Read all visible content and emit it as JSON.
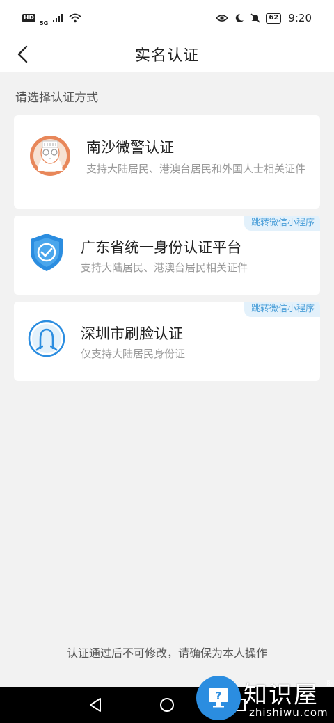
{
  "status_bar": {
    "left_badge": "HD",
    "network": "5G",
    "battery": "62",
    "time": "9:20"
  },
  "nav": {
    "title": "实名认证"
  },
  "section_label": "请选择认证方式",
  "cards": [
    {
      "title": "南沙微警认证",
      "desc": "支持大陆居民、港澳台居民和外国人士相关证件",
      "tag": "",
      "icon": "police-avatar-icon"
    },
    {
      "title": "广东省统一身份认证平台",
      "desc": "支持大陆居民、港澳台居民相关证件",
      "tag": "跳转微信小程序",
      "icon": "shield-check-icon"
    },
    {
      "title": "深圳市刷脸认证",
      "desc": "仅支持大陆居民身份证",
      "tag": "跳转微信小程序",
      "icon": "face-scan-icon"
    }
  ],
  "footer_note": "认证通过后不可修改，请确保为本人操作",
  "watermark": {
    "text": "知识屋",
    "reg": "®",
    "sub": "zhishiwu.com"
  },
  "colors": {
    "accent_blue": "#2b8de0",
    "tag_bg": "#e3f1fb",
    "tag_text": "#4a9ed8",
    "avatar_orange": "#e8875a"
  }
}
